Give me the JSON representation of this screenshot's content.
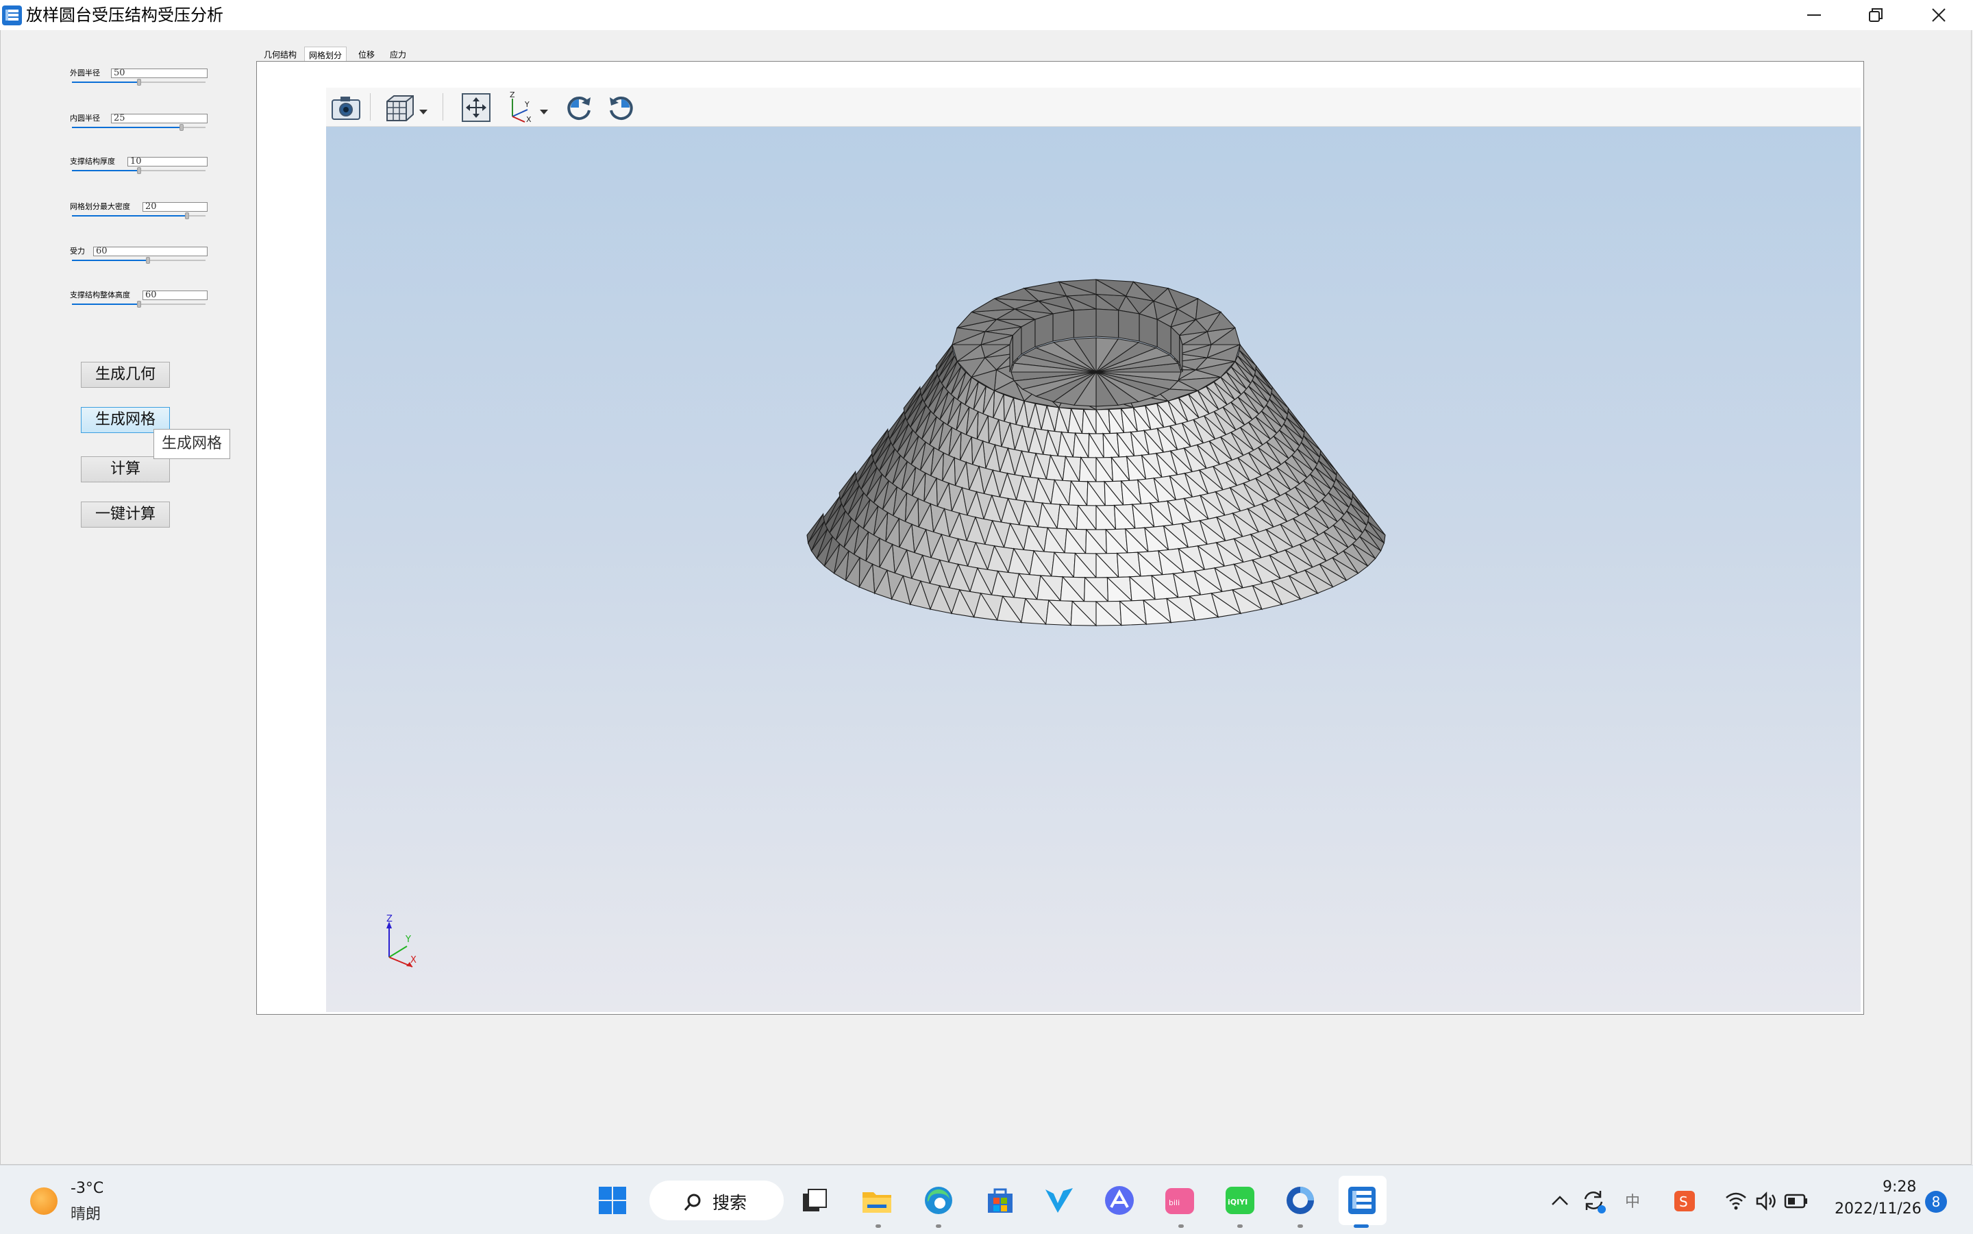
{
  "window": {
    "title": "放样圆台受压结构受压分析",
    "controls": [
      "minimize-icon",
      "restore-icon",
      "close-icon"
    ]
  },
  "params": [
    {
      "label": "外圆半径",
      "value": "50",
      "slider_fraction": 0.5
    },
    {
      "label": "内圆半径",
      "value": "25",
      "slider_fraction": 0.82
    },
    {
      "label": "支撑结构厚度",
      "value": "10",
      "slider_fraction": 0.5
    },
    {
      "label": "网格划分最大密度",
      "value": "20",
      "slider_fraction": 0.86
    },
    {
      "label": "受力",
      "value": "60",
      "slider_fraction": 0.57
    },
    {
      "label": "支撑结构整体高度",
      "value": "60",
      "slider_fraction": 0.5
    }
  ],
  "buttons": {
    "gen_geometry": "生成几何",
    "gen_mesh": "生成网格",
    "compute": "计算",
    "one_click": "一键计算"
  },
  "tooltip": "生成网格",
  "tabs": [
    {
      "label": "几何结构",
      "active": false
    },
    {
      "label": "网格划分",
      "active": true
    },
    {
      "label": "位移",
      "active": false
    },
    {
      "label": "应力",
      "active": false
    }
  ],
  "toolbar": [
    "camera-icon",
    "view-cube-icon",
    "fit-view-icon",
    "axes-orientation-icon",
    "rotate-cw-icon",
    "rotate-ccw-icon"
  ],
  "axis_triad": {
    "z": "Z",
    "y": "Y",
    "x": "X"
  },
  "taskbar": {
    "weather_temp": "-3°C",
    "weather_desc": "晴朗",
    "search_label": "搜索",
    "ime": "中",
    "time": "9:28",
    "date": "2022/11/26",
    "notification_count": "8"
  },
  "colors": {
    "accent": "#0a6fd6",
    "viewport_top": "#b9cfe6",
    "viewport_bottom": "#e7e8ee"
  }
}
